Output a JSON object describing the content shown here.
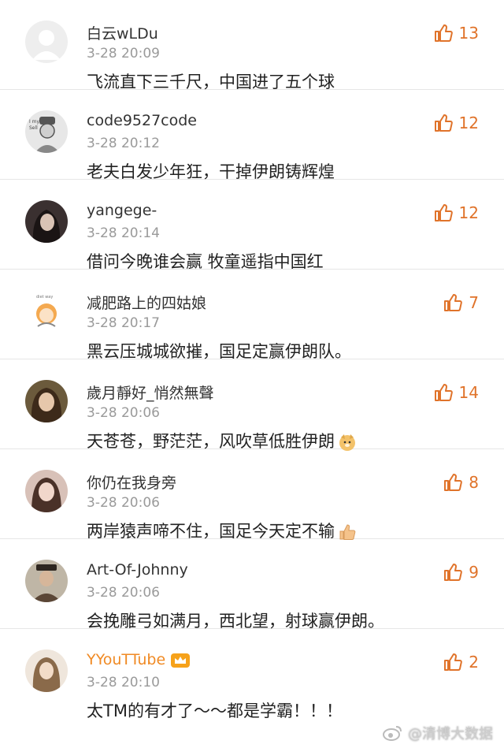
{
  "comments": [
    {
      "name": "白云wLDu",
      "time": "3-28 20:09",
      "text": "飞流直下三千尺，中国进了五个球",
      "likes": "13"
    },
    {
      "name": "code9527code",
      "time": "3-28 20:12",
      "text": "老夫白发少年狂，干掉伊朗铸辉煌",
      "likes": "12"
    },
    {
      "name": "yangege-",
      "time": "3-28 20:14",
      "text": "借问今晚谁会赢 牧童遥指中国红",
      "likes": "12"
    },
    {
      "name": "减肥路上的四姑娘",
      "time": "3-28 20:17",
      "text": "黑云压城城欲摧，国足定赢伊朗队。",
      "likes": "7"
    },
    {
      "name": "歲月靜好_悄然無聲",
      "time": "3-28 20:06",
      "text": "天苍苍，野茫茫，风吹草低胜伊朗",
      "likes": "14"
    },
    {
      "name": "你仍在我身旁",
      "time": "3-28 20:06",
      "text": "两岸猿声啼不住，国足今天定不输",
      "likes": "8"
    },
    {
      "name": "Art-Of-Johnny",
      "time": "3-28 20:06",
      "text": "会挽雕弓如满月，西北望，射球赢伊朗。",
      "likes": "9"
    },
    {
      "name": "YYouTTube",
      "time": "3-28 20:10",
      "text": "太TM的有才了～～都是学霸！！！",
      "likes": "2"
    }
  ],
  "watermark": "@清博大数据",
  "colors": {
    "accent": "#e0732a",
    "vip_name": "#f08a24",
    "time": "#9a9a9a"
  }
}
